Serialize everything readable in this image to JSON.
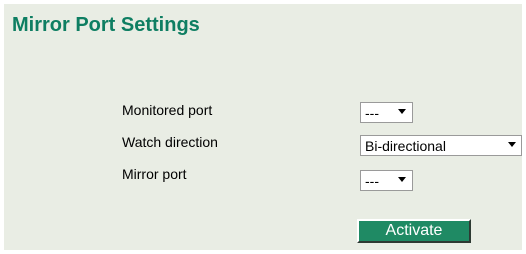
{
  "page": {
    "title": "Mirror Port Settings"
  },
  "form": {
    "monitored_port": {
      "label": "Monitored port",
      "value": "---"
    },
    "watch_direction": {
      "label": "Watch direction",
      "value": "Bi-directional"
    },
    "mirror_port": {
      "label": "Mirror port",
      "value": "---"
    }
  },
  "actions": {
    "activate_label": "Activate"
  },
  "colors": {
    "title": "#0e7e62",
    "panel_background": "#e9ede4",
    "button_background": "#1f8a64"
  },
  "icons": {
    "dropdown": "chevron-down-icon"
  }
}
